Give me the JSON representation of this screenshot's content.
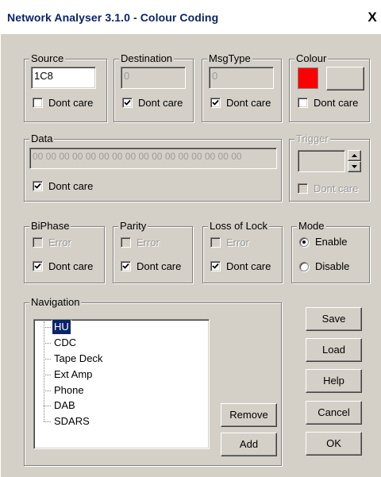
{
  "window": {
    "title": "Network Analyser 3.1.0 - Colour Coding",
    "close_label": "X"
  },
  "source": {
    "legend": "Source",
    "value": "1C8",
    "dont_care_label": "Dont care",
    "dont_care_checked": false
  },
  "destination": {
    "legend": "Destination",
    "value": "0",
    "dont_care_label": "Dont care",
    "dont_care_checked": true
  },
  "msgtype": {
    "legend": "MsgType",
    "value": "0",
    "dont_care_label": "Dont care",
    "dont_care_checked": true
  },
  "colour": {
    "legend": "Colour",
    "swatch_color": "#ff0000",
    "dont_care_label": "Dont care",
    "dont_care_checked": false
  },
  "data": {
    "legend": "Data",
    "value": "00 00 00 00 00 00 00 00 00 00 00 00 00 00 00 00",
    "dont_care_label": "Dont care",
    "dont_care_checked": true
  },
  "trigger": {
    "legend": "Trigger",
    "value": "",
    "dont_care_label": "Dont care",
    "dont_care_checked": false
  },
  "biphase": {
    "legend": "BiPhase",
    "error_label": "Error",
    "dont_care_label": "Dont care",
    "dont_care_checked": true
  },
  "parity": {
    "legend": "Parity",
    "error_label": "Error",
    "dont_care_label": "Dont care",
    "dont_care_checked": true
  },
  "loss_of_lock": {
    "legend": "Loss of Lock",
    "error_label": "Error",
    "dont_care_label": "Dont care",
    "dont_care_checked": true
  },
  "mode": {
    "legend": "Mode",
    "options": [
      "Enable",
      "Disable"
    ],
    "selected": "Enable"
  },
  "navigation": {
    "legend": "Navigation",
    "items": [
      "HU",
      "CDC",
      "Tape Deck",
      "Ext Amp",
      "Phone",
      "DAB",
      "SDARS"
    ],
    "selected": "HU",
    "remove_label": "Remove",
    "add_label": "Add"
  },
  "buttons": {
    "save": "Save",
    "load": "Load",
    "help": "Help",
    "cancel": "Cancel",
    "ok": "OK"
  }
}
